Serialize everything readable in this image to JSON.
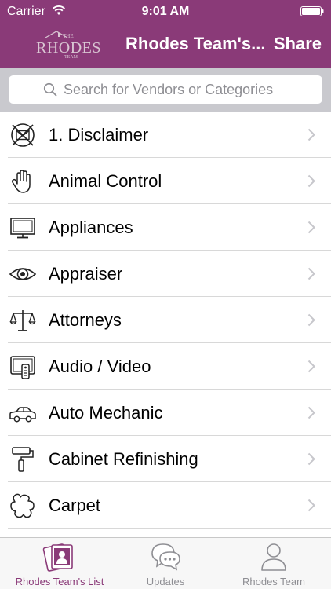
{
  "status_bar": {
    "carrier": "Carrier",
    "time": "9:01 AM"
  },
  "nav": {
    "title": "Rhodes Team's...",
    "share_label": "Share",
    "logo": {
      "top": "THE",
      "main": "RHODES",
      "bottom": "TEAM"
    }
  },
  "search": {
    "placeholder": "Search for Vendors or Categories",
    "value": ""
  },
  "list": {
    "items": [
      {
        "label": "1. Disclaimer",
        "icon": "no-mail-icon"
      },
      {
        "label": "Animal Control",
        "icon": "hand-icon"
      },
      {
        "label": "Appliances",
        "icon": "monitor-icon"
      },
      {
        "label": "Appraiser",
        "icon": "eye-icon"
      },
      {
        "label": "Attorneys",
        "icon": "scales-icon"
      },
      {
        "label": "Audio / Video",
        "icon": "tv-remote-icon"
      },
      {
        "label": "Auto Mechanic",
        "icon": "car-icon"
      },
      {
        "label": "Cabinet Refinishing",
        "icon": "paint-roller-icon"
      },
      {
        "label": "Carpet",
        "icon": "carpet-icon"
      }
    ]
  },
  "tabbar": {
    "tabs": [
      {
        "label": "Rhodes Team's List",
        "icon": "contact-cards-icon",
        "active": true
      },
      {
        "label": "Updates",
        "icon": "chat-bubbles-icon",
        "active": false
      },
      {
        "label": "Rhodes Team",
        "icon": "person-icon",
        "active": false
      }
    ]
  },
  "colors": {
    "brand": "#8a3a78",
    "search_bg": "#c9c9ce",
    "placeholder": "#8e8e93",
    "chevron": "#c7c7cc"
  }
}
